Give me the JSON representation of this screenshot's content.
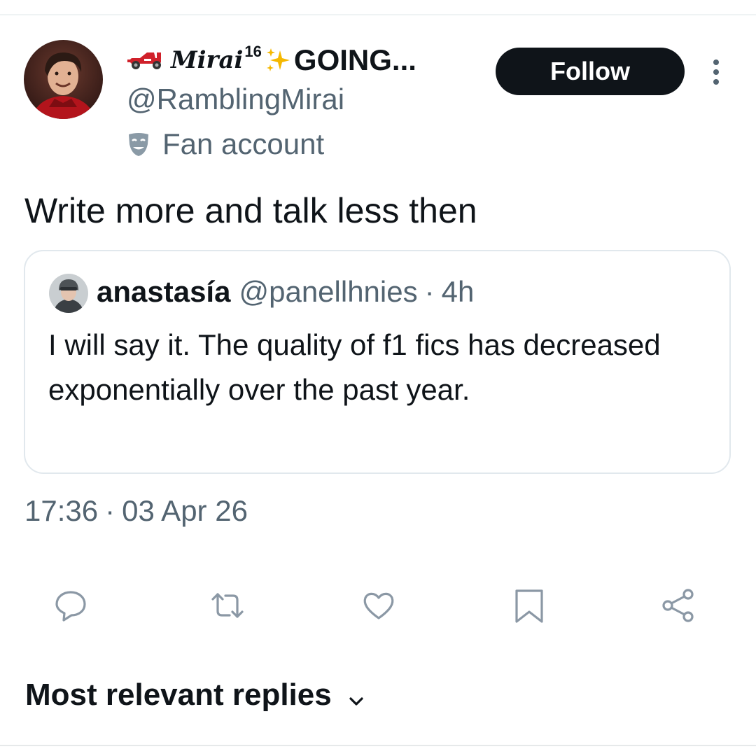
{
  "author": {
    "name_script": "Mirai",
    "name_sup": "16",
    "name_rest": "GOING...",
    "handle": "@RamblingMirai",
    "affiliation": "Fan account",
    "icons": [
      "race-car-icon",
      "sparkles-icon",
      "theater-mask-icon"
    ]
  },
  "follow_label": "Follow",
  "tweet_text": "Write more and talk less then",
  "quoted": {
    "name": "anastasía",
    "handle": "@panellhnies",
    "separator": "·",
    "time": "4h",
    "text": "I will say it. The quality of f1 fics has decreased exponentially over the past year."
  },
  "meta": {
    "time": "17:36",
    "separator": "·",
    "date": "03 Apr 26"
  },
  "actions": [
    "reply-icon",
    "retweet-icon",
    "like-icon",
    "bookmark-icon",
    "share-icon"
  ],
  "replies_sort_label": "Most relevant replies",
  "colors": {
    "text": "#0f1419",
    "secondary": "#536471",
    "border": "#e1e8ed",
    "follow_bg": "#0f1419"
  }
}
